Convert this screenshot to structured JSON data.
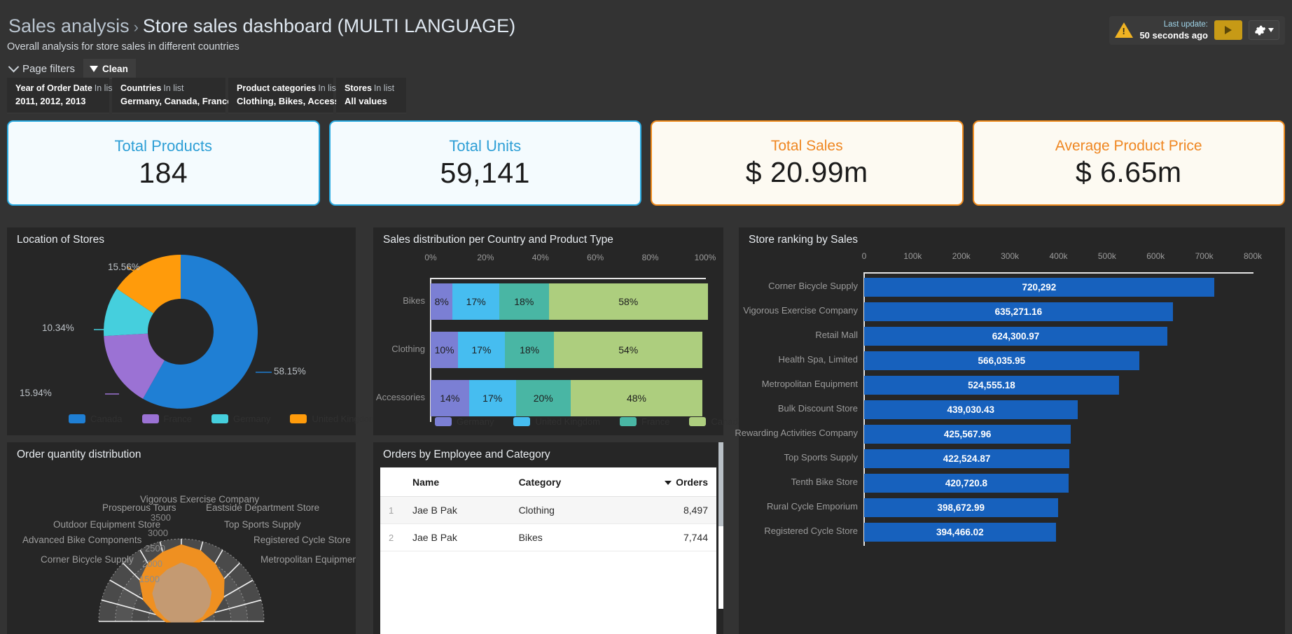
{
  "header": {
    "breadcrumb_root": "Sales analysis",
    "breadcrumb_sep": "›",
    "breadcrumb_current": "Store sales dashboard (MULTI LANGUAGE)",
    "subtitle": "Overall analysis for store sales in different countries",
    "page_filters_label": "Page filters",
    "clean_label": "Clean",
    "last_update_label": "Last update:",
    "last_update_value": "50 seconds ago"
  },
  "filters": [
    {
      "field": "Year of Order Date",
      "operator": "In list",
      "value": "2011, 2012, 2013"
    },
    {
      "field": "Countries",
      "operator": "In list",
      "value": "Germany, Canada, France ..."
    },
    {
      "field": "Product categories",
      "operator": "In list",
      "value": "Clothing, Bikes, Access ..."
    },
    {
      "field": "Stores",
      "operator": "In list",
      "value": "All values"
    }
  ],
  "kpis": [
    {
      "title": "Total Products",
      "value": "184",
      "accent": "#29aae1"
    },
    {
      "title": "Total Units",
      "value": "59,141",
      "accent": "#29aae1"
    },
    {
      "title": "Total Sales",
      "value": "$ 20.99m",
      "accent": "#f08b1d"
    },
    {
      "title": "Average Product Price",
      "value": "$ 6.65m",
      "accent": "#f08b1d"
    }
  ],
  "panels": {
    "donut_title": "Location of Stores",
    "stacked_title": "Sales distribution per Country and Product Type",
    "ranking_title": "Store ranking by Sales",
    "radar_title": "Order quantity distribution",
    "table_title": "Orders by Employee and Category"
  },
  "chart_data": [
    {
      "type": "pie",
      "title": "Location of Stores",
      "legend_position": "bottom",
      "labels": [
        "Canada",
        "France",
        "Germany",
        "United Kingdom"
      ],
      "values": [
        58.15,
        15.94,
        10.34,
        15.56
      ],
      "value_labels": [
        "58.15%",
        "15.94%",
        "10.34%",
        "15.56%"
      ],
      "colors": [
        "#1f7fd4",
        "#9b72d4",
        "#45cfdd",
        "#ff9b0b"
      ]
    },
    {
      "type": "bar",
      "title": "Sales distribution per Country and Product Type",
      "orientation": "horizontal",
      "stacked": true,
      "normalized": true,
      "xlabel": "",
      "ylabel": "",
      "xlim": [
        0,
        100
      ],
      "xticks": [
        "0%",
        "20%",
        "40%",
        "60%",
        "80%",
        "100%"
      ],
      "categories": [
        "Bikes",
        "Clothing",
        "Accessories"
      ],
      "legend_position": "bottom",
      "series": [
        {
          "name": "Germany",
          "color": "#7b7fd4",
          "values": [
            8,
            10,
            14
          ],
          "labels": [
            "8%",
            "10%",
            "14%"
          ]
        },
        {
          "name": "United Kingdom",
          "color": "#46bdf0",
          "values": [
            17,
            17,
            17
          ],
          "labels": [
            "17%",
            "17%",
            "17%"
          ]
        },
        {
          "name": "France",
          "color": "#49b6a4",
          "values": [
            18,
            18,
            20
          ],
          "labels": [
            "18%",
            "18%",
            "20%"
          ]
        },
        {
          "name": "Canada",
          "color": "#adce7e",
          "values": [
            58,
            54,
            48
          ],
          "labels": [
            "58%",
            "54%",
            "48%"
          ]
        }
      ]
    },
    {
      "type": "bar",
      "title": "Store ranking by Sales",
      "orientation": "horizontal",
      "xlabel": "",
      "ylabel": "",
      "xlim": [
        0,
        800000
      ],
      "xticks": [
        "0",
        "100k",
        "200k",
        "300k",
        "400k",
        "500k",
        "600k",
        "700k",
        "800k"
      ],
      "bar_color": "#1761bd",
      "categories": [
        "Corner Bicycle Supply",
        "Vigorous Exercise Company",
        "Retail Mall",
        "Health Spa, Limited",
        "Metropolitan Equipment",
        "Bulk Discount Store",
        "Rewarding Activities Company",
        "Top Sports Supply",
        "Tenth Bike Store",
        "Rural Cycle Emporium",
        "Registered Cycle Store"
      ],
      "values": [
        720292,
        635271.16,
        624300.97,
        566035.95,
        524555.18,
        439030.43,
        425567.96,
        422524.87,
        420720.8,
        398672.99,
        394466.02
      ],
      "value_labels": [
        "720,292",
        "635,271.16",
        "624,300.97",
        "566,035.95",
        "524,555.18",
        "439,030.43",
        "425,567.96",
        "422,524.87",
        "420,720.8",
        "398,672.99",
        "394,466.02"
      ]
    },
    {
      "type": "area",
      "subtype": "radar",
      "title": "Order quantity distribution",
      "ring_labels": [
        "3500",
        "3000",
        "2500",
        "2000",
        "1500"
      ],
      "axis_labels": [
        "Vigorous Exercise Company",
        "Eastside Department Store",
        "Top Sports Supply",
        "Registered Cycle Store",
        "Metropolitan Equipment",
        "Corner Bicycle Supply",
        "Advanced Bike Components",
        "Outdoor Equipment Store",
        "Prosperous Tours"
      ],
      "colors": [
        "#ef9021",
        "#c49a72"
      ]
    }
  ],
  "table": {
    "columns": [
      "",
      "Name",
      "Category",
      "Orders"
    ],
    "sorted_column": "Orders",
    "rows": [
      {
        "idx": "1",
        "name": "Jae B Pak",
        "category": "Clothing",
        "orders": "8,497"
      },
      {
        "idx": "2",
        "name": "Jae B Pak",
        "category": "Bikes",
        "orders": "7,744"
      }
    ]
  }
}
